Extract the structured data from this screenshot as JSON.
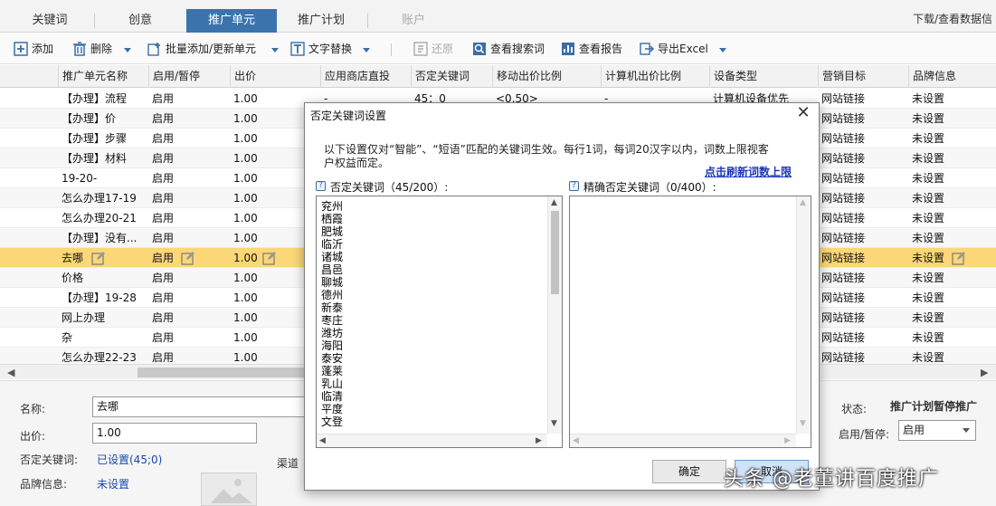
{
  "tabs": [
    {
      "label": "关键词",
      "state": "normal"
    },
    {
      "label": "创意",
      "state": "normal"
    },
    {
      "label": "推广单元",
      "state": "active"
    },
    {
      "label": "推广计划",
      "state": "normal"
    },
    {
      "label": "账户",
      "state": "disabled"
    }
  ],
  "tab_right_label": "下载/查看数据信",
  "toolbar": {
    "add": "添加",
    "delete": "删除",
    "bulk_add": "批量添加/更新单元",
    "replace_text": "文字替换",
    "restore": "还原",
    "view_search_terms": "查看搜索词",
    "view_report": "查看报告",
    "export_excel": "导出Excel"
  },
  "grid": {
    "columns": [
      "推广单元名称",
      "启用/暂停",
      "出价",
      "应用商店直投",
      "否定关键词",
      "移动出价比例",
      "计算机出价比例",
      "设备类型",
      "营销目标",
      "品牌信息"
    ],
    "rows": [
      {
        "name": "【办理】流程",
        "status": "启用",
        "bid": "1.00",
        "app": "-",
        "neg": "45：0",
        "mobile": "<0.50>",
        "pc": "-",
        "device": "计算机设备优先",
        "target": "网站链接",
        "brand": "未设置"
      },
      {
        "name": "【办理】价",
        "status": "启用",
        "bid": "1.00",
        "target": "网站链接",
        "brand": "未设置"
      },
      {
        "name": "【办理】步骤",
        "status": "启用",
        "bid": "1.00",
        "target": "网站链接",
        "brand": "未设置"
      },
      {
        "name": "【办理】材料",
        "status": "启用",
        "bid": "1.00",
        "target": "网站链接",
        "brand": "未设置"
      },
      {
        "name": "19-20-",
        "status": "启用",
        "bid": "1.00",
        "target": "网站链接",
        "brand": "未设置"
      },
      {
        "name": "怎么办理17-19",
        "status": "启用",
        "bid": "1.00",
        "target": "网站链接",
        "brand": "未设置"
      },
      {
        "name": "怎么办理20-21",
        "status": "启用",
        "bid": "1.00",
        "target": "网站链接",
        "brand": "未设置"
      },
      {
        "name": "【办理】没有...",
        "status": "启用",
        "bid": "1.00",
        "target": "网站链接",
        "brand": "未设置"
      },
      {
        "name": "去哪",
        "status": "启用",
        "bid": "1.00",
        "target": "网站链接",
        "brand": "未设置"
      },
      {
        "name": "价格",
        "status": "启用",
        "bid": "1.00",
        "target": "网站链接",
        "brand": "未设置"
      },
      {
        "name": "【办理】19-28",
        "status": "启用",
        "bid": "1.00",
        "target": "网站链接",
        "brand": "未设置"
      },
      {
        "name": "网上办理",
        "status": "启用",
        "bid": "1.00",
        "target": "网站链接",
        "brand": "未设置"
      },
      {
        "name": "杂",
        "status": "启用",
        "bid": "1.00",
        "target": "网站链接",
        "brand": "未设置"
      },
      {
        "name": "怎么办理22-23",
        "status": "启用",
        "bid": "1.00",
        "target": "网站链接",
        "brand": "未设置"
      }
    ],
    "selected_row_index": 8
  },
  "form": {
    "name_label": "名称:",
    "name_value": "去哪",
    "bid_label": "出价:",
    "bid_value": "1.00",
    "neg_label": "否定关键词:",
    "neg_value": "已设置(45;0)",
    "brand_label": "品牌信息:",
    "brand_value": "未设置",
    "channel_label": "渠道",
    "status_label": "状态:",
    "status_value": "推广计划暂停推广",
    "toggle_label": "启用/暂停:",
    "toggle_value": "启用"
  },
  "dialog": {
    "title": "否定关键词设置",
    "desc": "以下设置仅对“智能”、“短语”匹配的关键词生效。每行1词，每词20汉字以内，词数上限视客户权益而定。",
    "refresh_link": "点击刷新词数上限",
    "neg_list_label": "否定关键词（45/200）:",
    "exact_list_label": "精确否定关键词（0/400）:",
    "neg_keywords": [
      "兖州",
      "栖霞",
      "肥城",
      "临沂",
      "诸城",
      "昌邑",
      "聊城",
      "德州",
      "新泰",
      "枣庄",
      "潍坊",
      "海阳",
      "泰安",
      "蓬莱",
      "乳山",
      "临清",
      "平度",
      "文登"
    ],
    "ok_label": "确定",
    "cancel_label": "取消"
  },
  "watermark": "头条 @老董讲百度推广",
  "colors": {
    "accent": "#3b73ac",
    "selected_row": "#fbd777",
    "link": "#1a48b5"
  }
}
